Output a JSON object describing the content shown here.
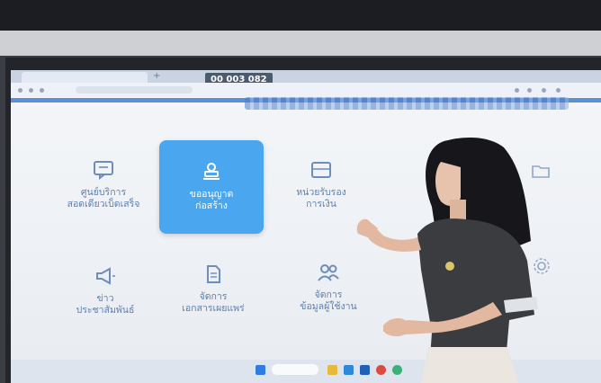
{
  "overlay_badge": "00 003 082",
  "tiles": [
    {
      "label": "ศูนย์บริการ",
      "label2": "สอดเดียวเบ็ดเสร็จ",
      "icon": "chat-icon"
    },
    {
      "label": "ขออนุญาต",
      "label2": "ก่อสร้าง",
      "icon": "stamp-icon",
      "featured": true
    },
    {
      "label": "หน่วยรับรอง",
      "label2": "การเงิน",
      "icon": "inbox-icon"
    },
    {
      "label": "ข่าว",
      "label2": "ประชาสัมพันธ์",
      "icon": "megaphone-icon"
    },
    {
      "label": "จัดการ",
      "label2": "เอกสารเผยแพร่",
      "icon": "document-icon"
    },
    {
      "label": "จัดการ",
      "label2": "ข้อมูลผู้ใช้งาน",
      "icon": "users-icon"
    }
  ],
  "colors": {
    "accent": "#4aa6ee",
    "tile_text": "#5d7fae",
    "header_line": "#5b8fd9"
  }
}
